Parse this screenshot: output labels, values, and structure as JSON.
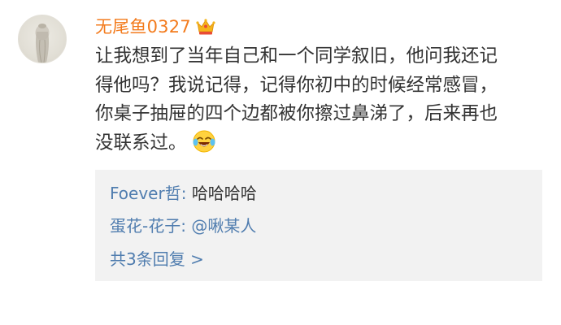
{
  "comment": {
    "username": "无尾鱼0327",
    "avatar_icon": "avatar-icon",
    "badge_icon": "crown-icon",
    "accent_color": "#f37b1d",
    "lines": [
      "让我想到了当年自己和一个同学叙旧，他问我还记",
      "得他吗？我说记得，记得你初中的时候经常感冒，",
      "你桌子抽屉的四个边都被你擦过鼻涕了，后来再也",
      "没联系过。"
    ],
    "emoji_icon": "laugh-cry-emoji-icon"
  },
  "replies": {
    "items": [
      {
        "user": "Foever哲",
        "colon": ": ",
        "text": "哈哈哈哈"
      },
      {
        "user": "蛋花-花子",
        "colon": ": ",
        "mention": "@啾某人"
      }
    ],
    "view_more": "共3条回复 >",
    "link_color": "#507daf",
    "background": "#f2f2f2"
  }
}
